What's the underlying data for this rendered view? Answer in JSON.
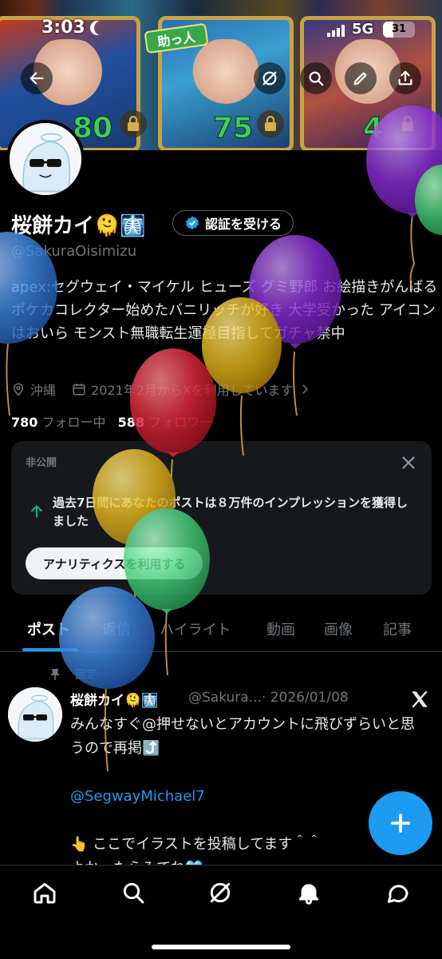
{
  "status_bar": {
    "time": "3:03",
    "network": "5G",
    "battery": "31"
  },
  "banner": {
    "badge": "助っ人",
    "card_numbers": [
      "80",
      "75",
      "4"
    ]
  },
  "profile": {
    "display_name": "桜餅カイ🫠🩻",
    "verify_label": "認証を受ける",
    "handle": "@SakuraOisimizu",
    "bio": "apex:セグウェイ・マイケル ヒューズ グミ野郎 お絵描きがんばる ポケカコレクター始めたバニリッチが好き 大学受かった アイコンはおいら モンスト無職転生運極目指してガチャ禁中",
    "location": "沖縄",
    "joined": "2021年2月からXを利用しています",
    "following_count": "780",
    "following_label": "フォロー中",
    "followers_count": "588",
    "followers_label": "フォロワー"
  },
  "private_card": {
    "label": "非公開",
    "message": "過去7日間にあなたのポストは８万件のインプレッションを獲得しました",
    "button": "アナリティクスを利用する"
  },
  "tabs": [
    "ポスト",
    "返信",
    "ハイライト",
    "動画",
    "画像",
    "記事"
  ],
  "pinned_post": {
    "pinned_label": "固定",
    "author": "桜餅カイ🫠🩻",
    "meta": "@Sakura...· 2026/01/08",
    "line1": "みんなすぐ@押せないとアカウントに飛びずらいと思うので再掲⤴️",
    "mention": "@SegwayMichael7",
    "line2": "👆 ここでイラストを投稿してます＾＾",
    "line3": "よかったらみてね🩵"
  },
  "icons": [
    "back-icon",
    "grok-icon",
    "search-icon",
    "edit-icon",
    "share-icon",
    "verified-badge-icon",
    "location-icon",
    "calendar-icon",
    "chevron-right-icon",
    "close-icon",
    "arrow-up-icon",
    "pin-icon",
    "x-logo-icon",
    "plus-icon",
    "home-icon",
    "search-nav-icon",
    "grok-nav-icon",
    "bell-icon",
    "chat-icon",
    "lock-icon"
  ],
  "colors": {
    "accent": "#1d9bf0",
    "background": "#000000",
    "muted": "#71767b"
  }
}
